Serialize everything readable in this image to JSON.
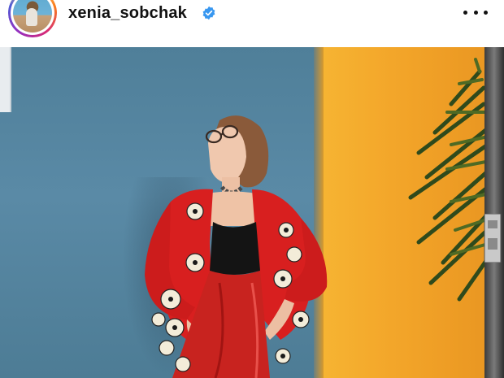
{
  "post_header": {
    "username": "xenia_sobchak",
    "verified": true,
    "more_icon": "more-horizontal-icon"
  },
  "colors": {
    "verified_badge": "#3897f0",
    "wall_blue": "#5a8aa6",
    "wall_orange": "#f3a62a",
    "cardigan_red": "#d81f1f",
    "skirt_red": "#c8231f"
  }
}
